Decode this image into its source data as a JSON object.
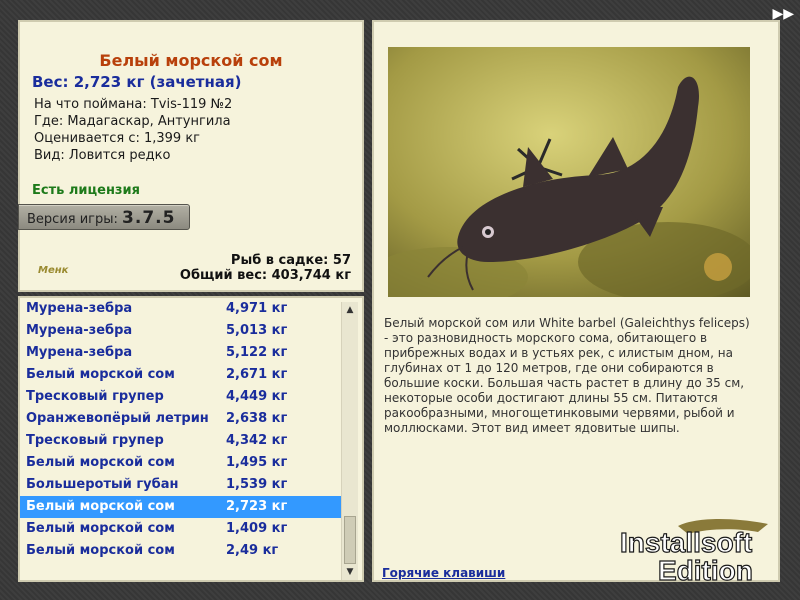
{
  "header": {
    "fish_name": "Белый морской сом",
    "weight_line": "Вес: 2,723 кг (зачетная)",
    "caught_on": "На что поймана: Tvis-119 №2",
    "location": "Где: Мадагаскар, Антунгила",
    "rated_from": "Оценивается с: 1,399 кг",
    "kind": "Вид: Ловится редко",
    "license": "Есть лицензия",
    "version_label": "Версия игры:",
    "version_number": "3.7.5",
    "small_logo": "Менк",
    "fish_in_keepnet": "Рыб в садке: 57",
    "total_weight": "Общий вес: 403,744 кг"
  },
  "catch_list": [
    {
      "name": "Мурена-зебра",
      "weight": "4,971 кг"
    },
    {
      "name": "Мурена-зебра",
      "weight": "5,013 кг"
    },
    {
      "name": "Мурена-зебра",
      "weight": "5,122 кг"
    },
    {
      "name": "Белый морской сом",
      "weight": "2,671 кг"
    },
    {
      "name": "Тресковый групер",
      "weight": "4,449 кг"
    },
    {
      "name": "Оранжевопёрый летрин",
      "weight": "2,638 кг"
    },
    {
      "name": "Тресковый групер",
      "weight": "4,342 кг"
    },
    {
      "name": "Белый морской сом",
      "weight": "1,495 кг"
    },
    {
      "name": "Большеротый губан",
      "weight": "1,539 кг"
    },
    {
      "name": "Белый морской сом",
      "weight": "2,723 кг"
    },
    {
      "name": "Белый морской сом",
      "weight": "1,409 кг"
    },
    {
      "name": "Белый морской сом",
      "weight": "2,49 кг"
    }
  ],
  "selected_index": 9,
  "description": "Белый морской сом или White barbel (Galeichthys feliceps) - это разновидность морского сома, обитающего в прибрежных водах и в устьях рек, с илистым дном, на глубинах от 1 до 120 метров, где они собираются в большие коски. Большая часть растет в длину до 35 см, некоторые особи достигают длины 55 см. Питаются ракообразными, многощетинковыми червями, рыбой и моллюсками. Этот вид имеет ядовитые шипы.",
  "hotkeys": "Горячие клавиши",
  "watermark": {
    "line1": "Installsoft",
    "line2": "Edition"
  },
  "colors": {
    "selection": "#3399ff",
    "link_blue": "#1a2d9c",
    "title_orange": "#b8400b",
    "license_green": "#1d7a1a"
  }
}
